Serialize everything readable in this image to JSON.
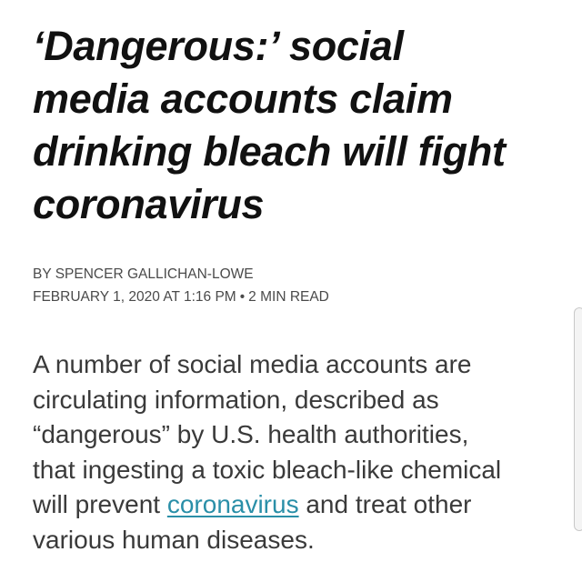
{
  "article": {
    "headline_lines": [
      "‘Dangerous:’ social",
      "media accounts claim",
      "drinking bleach will fight",
      "coronavirus"
    ],
    "byline": {
      "author": "BY SPENCER GALLICHAN-LOWE",
      "date": "FEBRUARY 1, 2020 AT 1:16 PM",
      "separator": "•",
      "read_time": "2 MIN READ"
    },
    "body": {
      "line1": "A number of social media accounts are",
      "line2": "circulating information, described as",
      "line3": "“dangerous” by U.S. health authorities,",
      "line4": "that ingesting a toxic bleach-like chemical",
      "line5_before": "will prevent ",
      "link_text": "coronavirus",
      "line5_after": " and treat other",
      "line6": "various human diseases."
    }
  },
  "colors": {
    "headline": "#111111",
    "byline": "#4a4a4a",
    "body": "#3a3a3a",
    "link": "#2a8fa8"
  }
}
